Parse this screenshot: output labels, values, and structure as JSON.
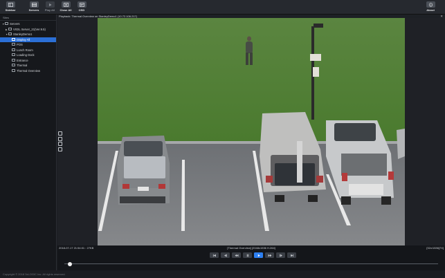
{
  "toolbar": {
    "sidebar_label": "Sidebar",
    "servers_label": "Servers",
    "play_all_label": "Play All",
    "close_all_label": "Close All",
    "osd_label": "OSD",
    "about_label": "About"
  },
  "sidebar": {
    "header": "Sites",
    "tree": [
      {
        "label": "Servers",
        "expanded": true
      },
      {
        "label": "VIGIL Server_21(Ver.9.5)",
        "expanded": false
      },
      {
        "label": "StanleyDemo1",
        "expanded": true
      },
      {
        "label": "Display All",
        "selected": true
      },
      {
        "label": "POS"
      },
      {
        "label": "Lunch Room"
      },
      {
        "label": "Loading Dock"
      },
      {
        "label": "Entrance"
      },
      {
        "label": "Thermal"
      },
      {
        "label": "Thermal Overview"
      }
    ]
  },
  "viewer": {
    "title": "Playback: Thermal Overview on StanleyDemo1 (10.72.106.217)",
    "timestamp": "2018-07-17 21:54:01 : 27KB",
    "camera_info": "[Thermal Overview] [2048x1536 H.264]",
    "stream_info": "[32x/1536]7X]"
  },
  "playback": {
    "buttons": [
      "first-frame",
      "step-back",
      "rewind",
      "pause",
      "play",
      "fast-forward",
      "step-forward",
      "last-frame"
    ],
    "active": "play",
    "position": 0.01
  },
  "footer": {
    "copyright": "Copyright © 2018 3xLOGIC Inc. All rights reserved."
  },
  "colors": {
    "accent": "#2b6fd6",
    "play_active": "#2d7ff0",
    "grass": "#4f7a34",
    "asphalt": "#7d7f82"
  }
}
